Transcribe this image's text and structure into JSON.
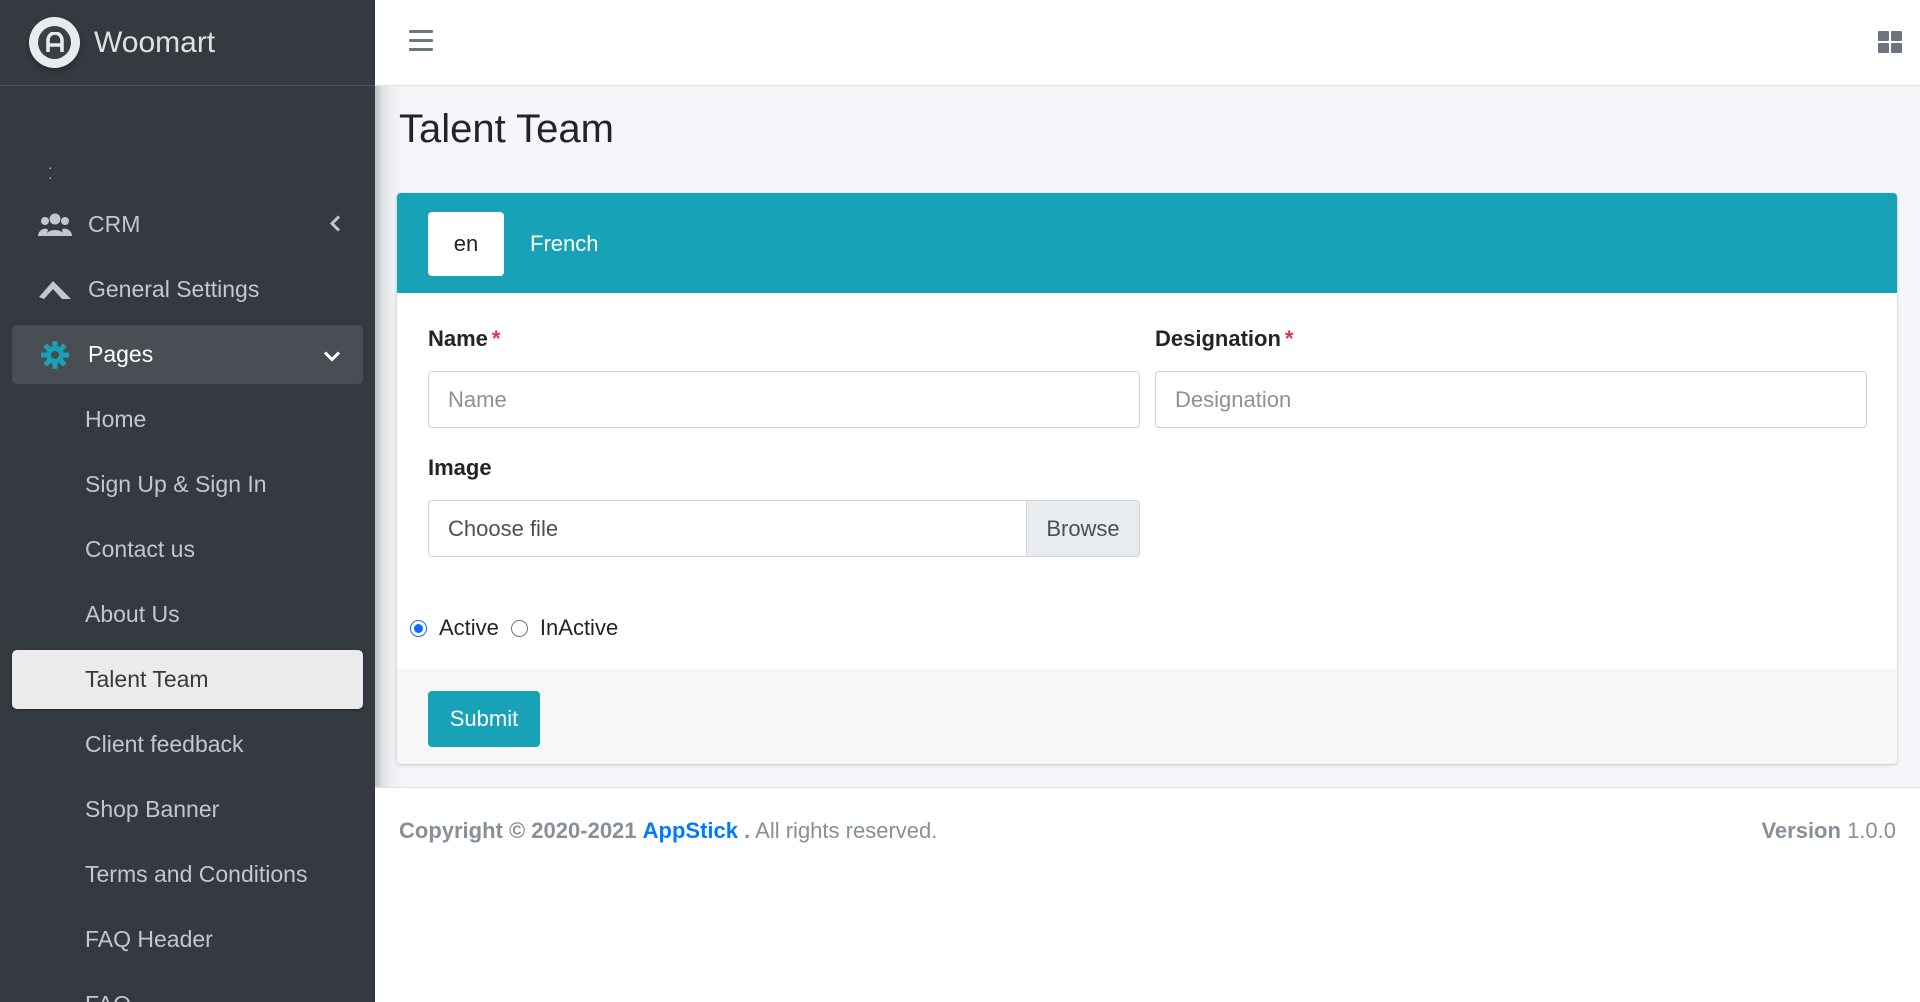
{
  "brand": {
    "name": "Woomart"
  },
  "sidebar": {
    "partial_top": "· ·",
    "items": [
      {
        "label": "CRM",
        "icon": "users-icon"
      },
      {
        "label": "General Settings",
        "icon": "settings-logo-icon"
      },
      {
        "label": "Pages",
        "icon": "gear-icon"
      }
    ],
    "sub_items": [
      {
        "label": "Home"
      },
      {
        "label": "Sign Up & Sign In"
      },
      {
        "label": "Contact us"
      },
      {
        "label": "About Us"
      },
      {
        "label": "Talent Team"
      },
      {
        "label": "Client feedback"
      },
      {
        "label": "Shop Banner"
      },
      {
        "label": "Terms and Conditions"
      },
      {
        "label": "FAQ Header"
      },
      {
        "label": "FAQ"
      }
    ]
  },
  "header": {
    "menu_icon": "hamburger-icon",
    "right_icon": "grid-icon"
  },
  "page": {
    "title": "Talent Team"
  },
  "tabs": [
    {
      "label": "en",
      "active": true
    },
    {
      "label": "French",
      "active": false
    }
  ],
  "form": {
    "name_label": "Name",
    "name_placeholder": "Name",
    "designation_label": "Designation",
    "designation_placeholder": "Designation",
    "required_mark": "*",
    "image_label": "Image",
    "file_placeholder": "Choose file",
    "browse_label": "Browse",
    "status_options": [
      {
        "label": "Active",
        "checked": true
      },
      {
        "label": "InActive",
        "checked": false
      }
    ],
    "submit_label": "Submit"
  },
  "footer": {
    "copyright_prefix": "Copyright © 2020-2021",
    "copyright_brand": "AppStick",
    "copyright_dot": ".",
    "copyright_suffix": "All rights reserved.",
    "version_label": "Version",
    "version_value": "1.0.0"
  },
  "colors": {
    "sidebar_bg": "#343a40",
    "accent": "#17a2b8",
    "link": "#007bff",
    "required": "#dc3545",
    "radio_checked": "#0d6efd"
  }
}
